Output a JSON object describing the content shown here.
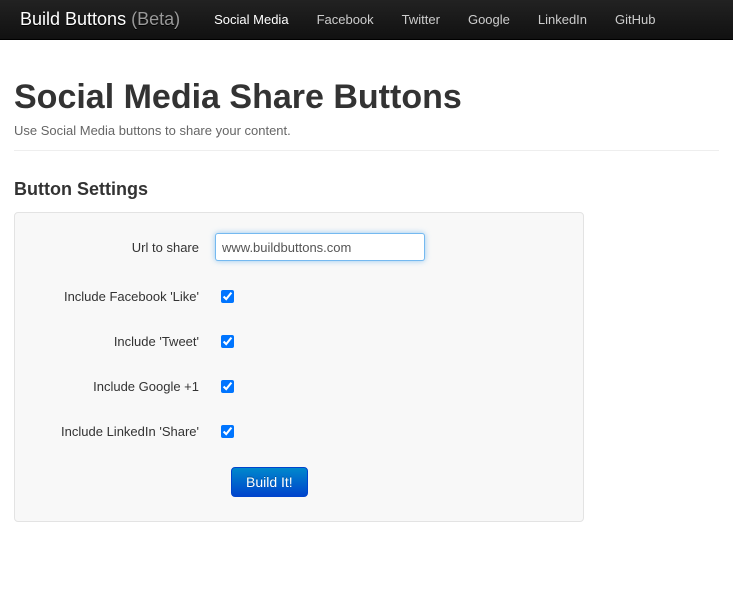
{
  "navbar": {
    "brand": "Build Buttons",
    "brand_suffix": "(Beta)",
    "items": [
      "Social Media",
      "Facebook",
      "Twitter",
      "Google",
      "LinkedIn",
      "GitHub"
    ]
  },
  "page": {
    "title": "Social Media Share Buttons",
    "lead": "Use Social Media buttons to share your content."
  },
  "settings": {
    "heading": "Button Settings",
    "url_label": "Url to share",
    "url_value": "www.buildbuttons.com",
    "facebook_label": "Include Facebook 'Like'",
    "facebook_checked": true,
    "tweet_label": "Include 'Tweet'",
    "tweet_checked": true,
    "google_label": "Include Google +1",
    "google_checked": true,
    "linkedin_label": "Include LinkedIn 'Share'",
    "linkedin_checked": true,
    "submit_label": "Build It!"
  }
}
